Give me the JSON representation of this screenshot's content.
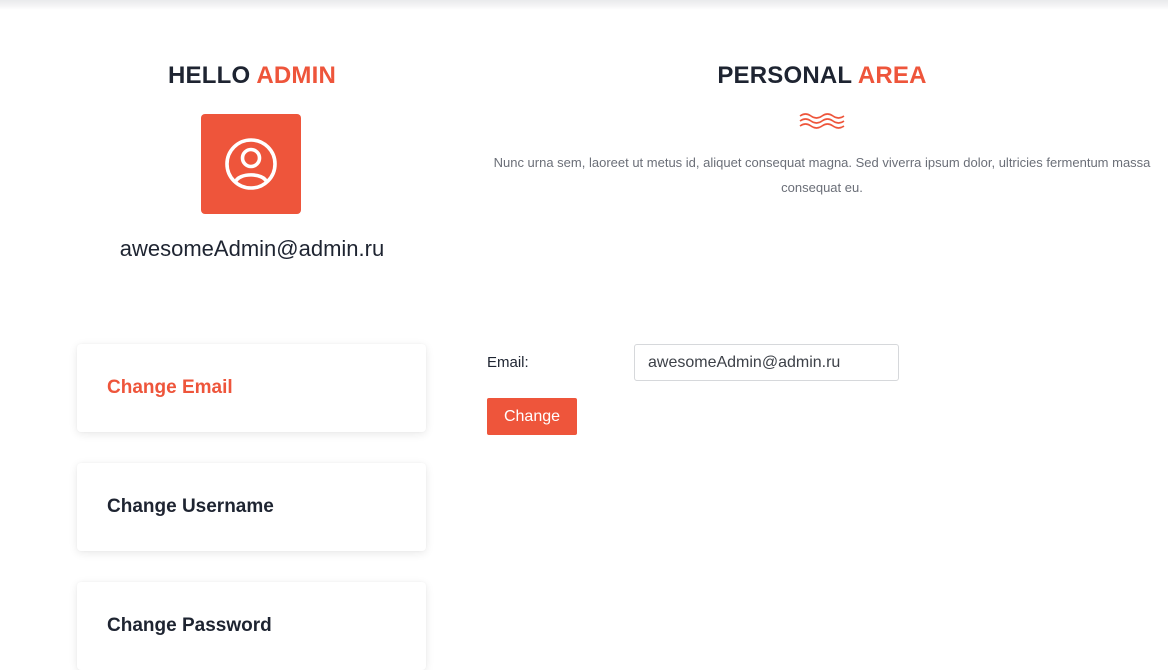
{
  "colors": {
    "accent": "#ee553b",
    "heading": "#1e2431",
    "body_text": "#6b6f78"
  },
  "sidebar": {
    "greeting_prefix": "HELLO",
    "greeting_highlight": "ADMIN",
    "avatar_icon": "user-circle-icon",
    "user_email": "awesomeAdmin@admin.ru",
    "menu_items": [
      {
        "label": "Change Email",
        "active": true
      },
      {
        "label": "Change Username",
        "active": false
      },
      {
        "label": "Change Password",
        "active": false
      }
    ]
  },
  "main": {
    "title_prefix": "PERSONAL",
    "title_highlight": "AREA",
    "divider_icon": "waves-icon",
    "description": "Nunc urna sem, laoreet ut metus id, aliquet consequat magna. Sed viverra ipsum dolor, ultricies fermentum massa consequat eu.",
    "form": {
      "email_label": "Email:",
      "email_value": "awesomeAdmin@admin.ru",
      "submit_label": "Change"
    }
  }
}
